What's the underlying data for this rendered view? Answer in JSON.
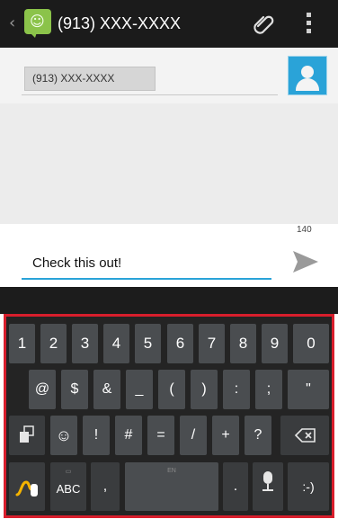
{
  "header": {
    "title": "(913) XXX-XXXX",
    "back_icon": "chevron-left-icon",
    "app_icon": "messaging-smiley-icon",
    "attach_icon": "paperclip-icon",
    "menu_icon": "overflow-menu-icon"
  },
  "recipient": {
    "chip_text": "(913) XXX-XXXX",
    "contact_icon": "contact-card-icon"
  },
  "compose": {
    "char_count": "140",
    "message": "Check this out!",
    "send_icon": "send-icon"
  },
  "keyboard": {
    "row1": [
      "1",
      "2",
      "3",
      "4",
      "5",
      "6",
      "7",
      "8",
      "9",
      "0"
    ],
    "row2": [
      "@",
      "$",
      "&",
      "_",
      "(",
      ")",
      ":",
      ";",
      "\""
    ],
    "row3": {
      "toggle_icon": "symbols-page-icon",
      "emoji_icon": "smiley-icon",
      "keys": [
        "!",
        "#",
        "=",
        "/",
        "+",
        "?"
      ],
      "backspace_icon": "backspace-icon"
    },
    "row4": {
      "swype_icon": "swype-icon",
      "abc": "ABC",
      "comma": ",",
      "space_sub": "EN",
      "period": ".",
      "mic_icon": "microphone-icon",
      "emoticon": ":-)"
    }
  },
  "colors": {
    "accent": "#2aa3d8",
    "keyboard_outline": "#d81e2c",
    "app_icon": "#8bc34a"
  }
}
